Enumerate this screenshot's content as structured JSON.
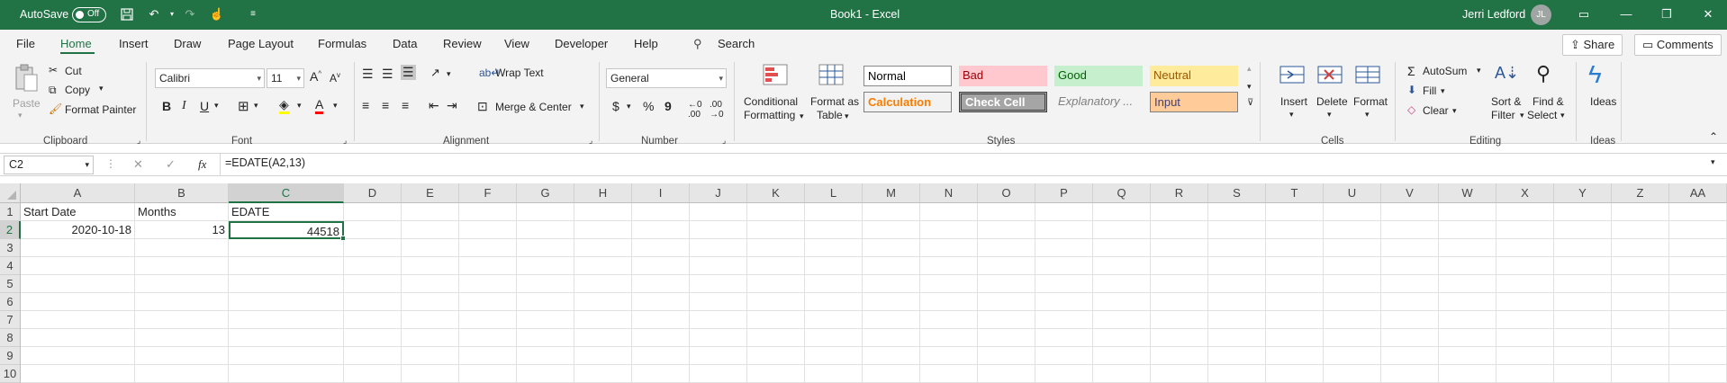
{
  "titlebar": {
    "autosave_label": "AutoSave",
    "autosave_state": "Off",
    "title": "Book1  -  Excel",
    "user_name": "Jerri Ledford",
    "user_initials": "JL"
  },
  "tabs": [
    "File",
    "Home",
    "Insert",
    "Draw",
    "Page Layout",
    "Formulas",
    "Data",
    "Review",
    "View",
    "Developer",
    "Help"
  ],
  "search_label": "Search",
  "share_label": "Share",
  "comments_label": "Comments",
  "ribbon": {
    "clipboard": {
      "paste": "Paste",
      "cut": "Cut",
      "copy": "Copy",
      "format_painter": "Format Painter",
      "group": "Clipboard"
    },
    "font": {
      "name": "Calibri",
      "size": "11",
      "bold": "B",
      "italic": "I",
      "underline": "U",
      "group": "Font"
    },
    "alignment": {
      "wrap": "Wrap Text",
      "merge": "Merge & Center",
      "group": "Alignment"
    },
    "number": {
      "format": "General",
      "currency": "$",
      "percent": "%",
      "comma": "9",
      "group": "Number"
    },
    "styles": {
      "conditional": "Conditional",
      "conditional2": "Formatting",
      "format_as": "Format as",
      "format_as2": "Table",
      "normal": "Normal",
      "bad": "Bad",
      "good": "Good",
      "neutral": "Neutral",
      "calculation": "Calculation",
      "check_cell": "Check Cell",
      "explanatory": "Explanatory ...",
      "input": "Input",
      "group": "Styles"
    },
    "cells": {
      "insert": "Insert",
      "delete": "Delete",
      "format": "Format",
      "group": "Cells"
    },
    "editing": {
      "autosum": "AutoSum",
      "fill": "Fill",
      "clear": "Clear",
      "sort": "Sort &",
      "sort2": "Filter",
      "find": "Find &",
      "find2": "Select",
      "group": "Editing"
    },
    "ideas": {
      "label": "Ideas",
      "group": "Ideas"
    }
  },
  "formula_bar": {
    "name_box": "C2",
    "fx": "fx",
    "formula": "=EDATE(A2,13)"
  },
  "columns": [
    "A",
    "B",
    "C",
    "D",
    "E",
    "F",
    "G",
    "H",
    "I",
    "J",
    "K",
    "L",
    "M",
    "N",
    "O",
    "P",
    "Q",
    "R",
    "S",
    "T",
    "U",
    "V",
    "W",
    "X",
    "Y",
    "Z",
    "AA"
  ],
  "rows": [
    "1",
    "2",
    "3",
    "4",
    "5",
    "6",
    "7",
    "8",
    "9",
    "10"
  ],
  "cells": {
    "A1": "Start Date",
    "B1": "Months",
    "C1": "EDATE",
    "A2": "2020-10-18",
    "B2": "13",
    "C2": "44518"
  },
  "colors": {
    "accent": "#217346",
    "bad_fill": "#ffc7ce",
    "bad_text": "#9c0006",
    "good_fill": "#c6efce",
    "good_text": "#006100",
    "neutral_fill": "#ffeb9c",
    "neutral_text": "#9c5700",
    "calc_text": "#fa7d00",
    "check_fill": "#a5a5a5",
    "input_fill": "#ffcc99"
  }
}
